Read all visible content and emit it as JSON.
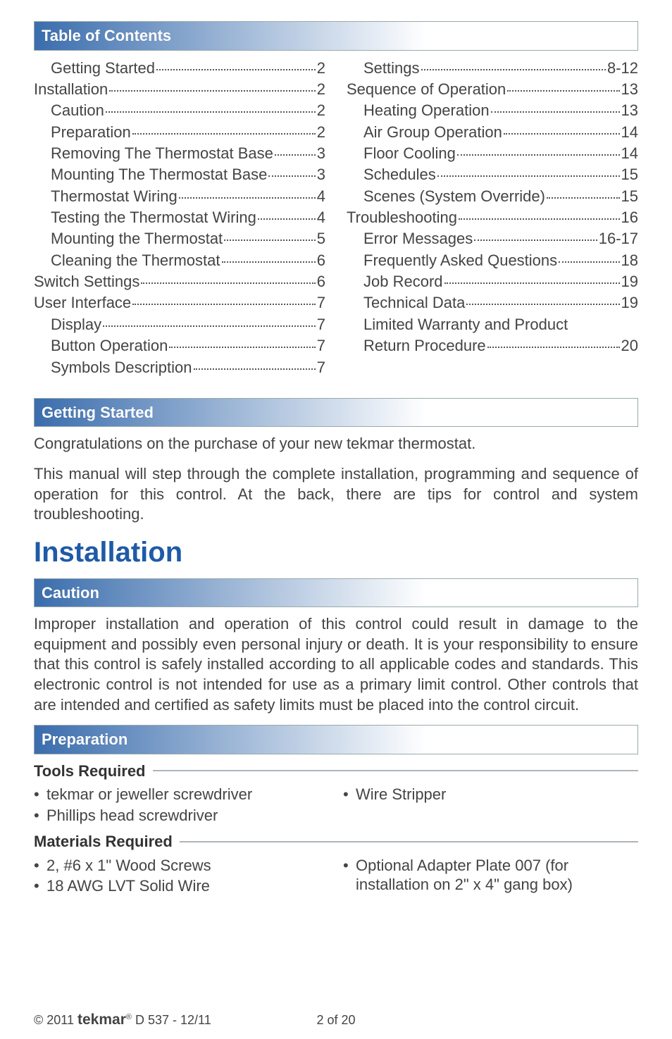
{
  "headers": {
    "toc": "Table of Contents",
    "getting_started": "Getting Started",
    "caution": "Caution",
    "preparation": "Preparation"
  },
  "toc_left": [
    {
      "label": "Getting Started",
      "page": "2",
      "indent": 1
    },
    {
      "label": "Installation",
      "page": "2",
      "indent": 0
    },
    {
      "label": "Caution",
      "page": "2",
      "indent": 1
    },
    {
      "label": "Preparation",
      "page": "2",
      "indent": 1
    },
    {
      "label": "Removing The Thermostat Base",
      "page": "3",
      "indent": 1
    },
    {
      "label": "Mounting The Thermostat Base",
      "page": "3",
      "indent": 1
    },
    {
      "label": "Thermostat Wiring",
      "page": "4",
      "indent": 1
    },
    {
      "label": "Testing the Thermostat Wiring",
      "page": "4",
      "indent": 1
    },
    {
      "label": "Mounting the Thermostat",
      "page": "5",
      "indent": 1
    },
    {
      "label": "Cleaning the Thermostat",
      "page": "6",
      "indent": 1
    },
    {
      "label": "Switch Settings",
      "page": "6",
      "indent": 0
    },
    {
      "label": "User Interface",
      "page": "7",
      "indent": 0
    },
    {
      "label": "Display",
      "page": "7",
      "indent": 1
    },
    {
      "label": "Button Operation",
      "page": "7",
      "indent": 1
    },
    {
      "label": "Symbols Description",
      "page": "7",
      "indent": 1
    }
  ],
  "toc_right": [
    {
      "label": "Settings",
      "page": "8-12",
      "indent": 1
    },
    {
      "label": "Sequence of Operation",
      "page": "13",
      "indent": 0
    },
    {
      "label": "Heating Operation",
      "page": "13",
      "indent": 1
    },
    {
      "label": "Air Group Operation",
      "page": "14",
      "indent": 1
    },
    {
      "label": "Floor Cooling",
      "page": "14",
      "indent": 1
    },
    {
      "label": "Schedules",
      "page": "15",
      "indent": 1
    },
    {
      "label": "Scenes (System Override)",
      "page": "15",
      "indent": 1
    },
    {
      "label": "Troubleshooting",
      "page": "16",
      "indent": 0
    },
    {
      "label": "Error Messages",
      "page": "16-17",
      "indent": 1
    },
    {
      "label": "Frequently Asked Questions",
      "page": "18",
      "indent": 1
    },
    {
      "label": "Job Record",
      "page": "19",
      "indent": 1
    },
    {
      "label": "Technical Data",
      "page": "19",
      "indent": 1
    },
    {
      "label": "Limited Warranty and Product Return Procedure",
      "page": "20",
      "indent": 1
    }
  ],
  "getting_started_p1": "Congratulations on the purchase of your new tekmar thermostat.",
  "getting_started_p2": "This manual will step through the complete installation, programming and sequence of operation for this control. At the back, there are tips for control and system troubleshooting.",
  "installation_heading": "Installation",
  "caution_text": "Improper installation and operation of this control could result in damage to the equipment and possibly even personal injury or death. It is your responsibility to ensure that this control is safely installed according to all applicable codes and standards. This electronic control is not intended for use as a primary limit control. Other controls that are intended and certified as safety limits must be placed into the control circuit.",
  "prep": {
    "tools_heading": "Tools Required",
    "materials_heading": "Materials Required",
    "tools_left": [
      "tekmar or jeweller screwdriver",
      "Phillips head screwdriver"
    ],
    "tools_right": [
      "Wire Stripper"
    ],
    "materials_left": [
      "2, #6 x 1\" Wood Screws",
      "18 AWG LVT Solid Wire"
    ],
    "materials_right": [
      "Optional Adapter Plate 007 (for installation on 2\" x 4\" gang box)"
    ]
  },
  "footer": {
    "copyright_prefix": "© 2011 ",
    "brand": "tekmar",
    "reg": "®",
    "doc": " D 537 - 12/11",
    "page": "2 of 20"
  }
}
